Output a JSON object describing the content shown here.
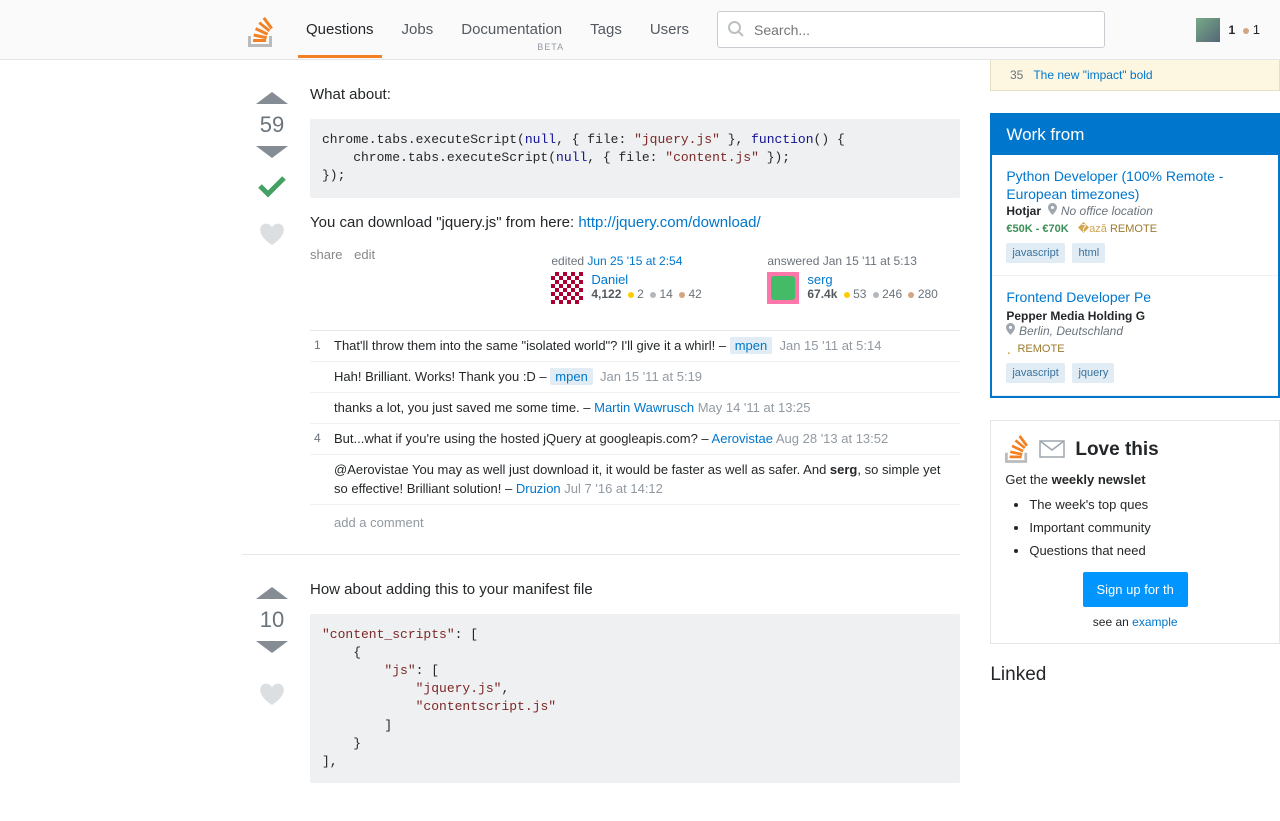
{
  "nav": {
    "items": [
      "Questions",
      "Jobs",
      "Documentation",
      "Tags",
      "Users"
    ],
    "beta": "BETA",
    "active": 0
  },
  "search": {
    "placeholder": "Search..."
  },
  "user": {
    "rep": "1",
    "bronze": "1"
  },
  "answer1": {
    "score": "59",
    "intro": "What about:",
    "download_text": "You can download \"jquery.js\" from here: ",
    "download_link": "http://jquery.com/download/",
    "menu": {
      "share": "share",
      "edit": "edit"
    },
    "edited": {
      "prefix": "edited ",
      "time": "Jun 25 '15 at 2:54",
      "name": "Daniel",
      "rep": "4,122",
      "gold": "2",
      "silver": "14",
      "bronze": "42"
    },
    "owner": {
      "prefix": "answered ",
      "time": "Jan 15 '11 at 5:13",
      "name": "serg",
      "rep": "67.4k",
      "gold": "53",
      "silver": "246",
      "bronze": "280"
    },
    "comments": [
      {
        "score": "1",
        "text": "That'll throw them into the same \"isolated world\"? I'll give it a whirl! – ",
        "user": "mpen",
        "user_tag": true,
        "time": "Jan 15 '11 at 5:14"
      },
      {
        "score": "",
        "text": "Hah! Brilliant. Works! Thank you :D – ",
        "user": "mpen",
        "user_tag": true,
        "time": "Jan 15 '11 at 5:19"
      },
      {
        "score": "",
        "text": "thanks a lot, you just saved me some time. – ",
        "user": "Martin Wawrusch",
        "user_tag": false,
        "time": "May 14 '11 at 13:25"
      },
      {
        "score": "4",
        "text": "But...what if you're using the hosted jQuery at googleapis.com? – ",
        "user": "Aerovistae",
        "user_tag": false,
        "time": "Aug 28 '13 at 13:52"
      },
      {
        "score": "",
        "text": "@Aerovistae You may as well just download it, it would be faster as well as safer. And ",
        "bold": "serg",
        "text2": ", so simple yet so effective! Brilliant solution! – ",
        "user": "Druzion",
        "user_tag": false,
        "time": "Jul 7 '16 at 14:12"
      }
    ],
    "add_comment": "add a comment"
  },
  "answer2": {
    "score": "10",
    "intro": "How about adding this to your manifest file"
  },
  "meta": {
    "count": "35",
    "title": "The new \"impact\" bold"
  },
  "jobs": {
    "heading": "Work from",
    "list": [
      {
        "title": "Python Developer (100% Remote - European timezones)",
        "company": "Hotjar",
        "location": "No office location",
        "salary": "€50K - €70K",
        "remote": "REMOTE",
        "tags": [
          "javascript",
          "html"
        ]
      },
      {
        "title": "Frontend Developer Pe",
        "company": "Pepper Media Holding G",
        "location": "Berlin, Deutschland",
        "salary": "",
        "remote": "REMOTE",
        "tags": [
          "javascript",
          "jquery"
        ]
      }
    ]
  },
  "newsletter": {
    "title": "Love this",
    "sub_pre": "Get the ",
    "sub_bold": "weekly newslet",
    "bullets": [
      "The week's top ques",
      "Important community",
      "Questions that need"
    ],
    "button": "Sign up for th",
    "example_pre": "see an ",
    "example_link": "example"
  },
  "linked": {
    "heading": "Linked"
  }
}
